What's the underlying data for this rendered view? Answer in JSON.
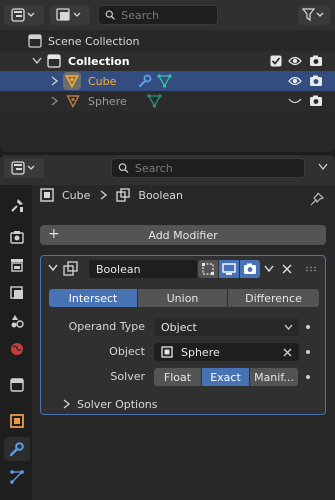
{
  "outliner": {
    "search_placeholder": "Search",
    "items": [
      {
        "label": "Scene Collection"
      },
      {
        "label": "Collection"
      },
      {
        "label": "Cube"
      },
      {
        "label": "Sphere"
      }
    ]
  },
  "properties": {
    "search_placeholder": "Search",
    "breadcrumb": {
      "object": "Cube",
      "modifier": "Boolean"
    },
    "add_modifier_label": "Add Modifier",
    "modifier": {
      "name": "Boolean",
      "operations": [
        "Intersect",
        "Union",
        "Difference"
      ],
      "selected_operation": "Intersect",
      "operand_type_label": "Operand Type",
      "operand_type_value": "Object",
      "object_label": "Object",
      "object_value": "Sphere",
      "solver_label": "Solver",
      "solver_options": [
        "Float",
        "Exact",
        "Manif..."
      ],
      "selected_solver": "Exact",
      "solver_options_label": "Solver Options"
    }
  },
  "colors": {
    "accent": "#4772b3",
    "selected_row": "#334d80",
    "cube_label": "#ffaf29",
    "modifier_icon": "#5c9fe6",
    "mesh_data_icon": "#35c3a1",
    "object_icon": "#e89a4a"
  },
  "icons": {
    "outliner_editor": "outliner-editor-icon",
    "filter": "filter-icon",
    "eye": "eye-icon",
    "camera": "render-camera-icon",
    "wrench": "wrench-icon",
    "pin": "pin-icon"
  }
}
